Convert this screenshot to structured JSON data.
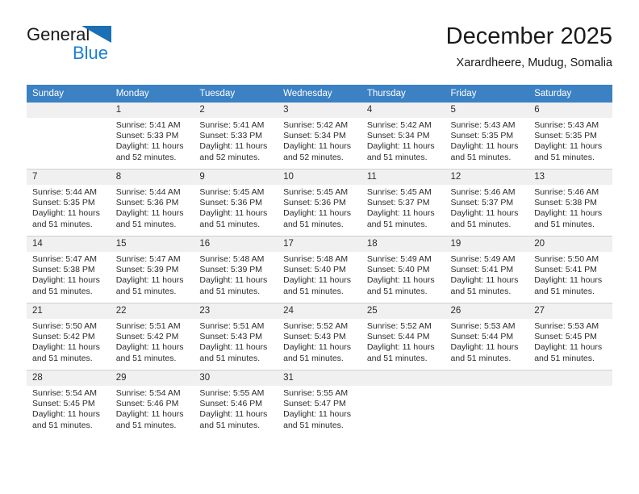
{
  "brand": {
    "name_part1": "General",
    "name_part2": "Blue",
    "accent_color": "#1a7fd4"
  },
  "header": {
    "title": "December 2025",
    "location": "Xarardheere, Mudug, Somalia"
  },
  "theme": {
    "header_row_bg": "#3b81c4",
    "daynum_bg": "#f0f0f0",
    "grid_line": "#cfcfcf",
    "text": "#2b2b2b"
  },
  "labels": {
    "sunrise_prefix": "Sunrise:",
    "sunset_prefix": "Sunset:",
    "daylight_prefix": "Daylight:"
  },
  "weekdays": [
    "Sunday",
    "Monday",
    "Tuesday",
    "Wednesday",
    "Thursday",
    "Friday",
    "Saturday"
  ],
  "weeks": [
    [
      {
        "day": "",
        "blank": true
      },
      {
        "day": "1",
        "sunrise": "Sunrise: 5:41 AM",
        "sunset": "Sunset: 5:33 PM",
        "daylight": "Daylight: 11 hours and 52 minutes."
      },
      {
        "day": "2",
        "sunrise": "Sunrise: 5:41 AM",
        "sunset": "Sunset: 5:33 PM",
        "daylight": "Daylight: 11 hours and 52 minutes."
      },
      {
        "day": "3",
        "sunrise": "Sunrise: 5:42 AM",
        "sunset": "Sunset: 5:34 PM",
        "daylight": "Daylight: 11 hours and 52 minutes."
      },
      {
        "day": "4",
        "sunrise": "Sunrise: 5:42 AM",
        "sunset": "Sunset: 5:34 PM",
        "daylight": "Daylight: 11 hours and 51 minutes."
      },
      {
        "day": "5",
        "sunrise": "Sunrise: 5:43 AM",
        "sunset": "Sunset: 5:35 PM",
        "daylight": "Daylight: 11 hours and 51 minutes."
      },
      {
        "day": "6",
        "sunrise": "Sunrise: 5:43 AM",
        "sunset": "Sunset: 5:35 PM",
        "daylight": "Daylight: 11 hours and 51 minutes."
      }
    ],
    [
      {
        "day": "7",
        "sunrise": "Sunrise: 5:44 AM",
        "sunset": "Sunset: 5:35 PM",
        "daylight": "Daylight: 11 hours and 51 minutes."
      },
      {
        "day": "8",
        "sunrise": "Sunrise: 5:44 AM",
        "sunset": "Sunset: 5:36 PM",
        "daylight": "Daylight: 11 hours and 51 minutes."
      },
      {
        "day": "9",
        "sunrise": "Sunrise: 5:45 AM",
        "sunset": "Sunset: 5:36 PM",
        "daylight": "Daylight: 11 hours and 51 minutes."
      },
      {
        "day": "10",
        "sunrise": "Sunrise: 5:45 AM",
        "sunset": "Sunset: 5:36 PM",
        "daylight": "Daylight: 11 hours and 51 minutes."
      },
      {
        "day": "11",
        "sunrise": "Sunrise: 5:45 AM",
        "sunset": "Sunset: 5:37 PM",
        "daylight": "Daylight: 11 hours and 51 minutes."
      },
      {
        "day": "12",
        "sunrise": "Sunrise: 5:46 AM",
        "sunset": "Sunset: 5:37 PM",
        "daylight": "Daylight: 11 hours and 51 minutes."
      },
      {
        "day": "13",
        "sunrise": "Sunrise: 5:46 AM",
        "sunset": "Sunset: 5:38 PM",
        "daylight": "Daylight: 11 hours and 51 minutes."
      }
    ],
    [
      {
        "day": "14",
        "sunrise": "Sunrise: 5:47 AM",
        "sunset": "Sunset: 5:38 PM",
        "daylight": "Daylight: 11 hours and 51 minutes."
      },
      {
        "day": "15",
        "sunrise": "Sunrise: 5:47 AM",
        "sunset": "Sunset: 5:39 PM",
        "daylight": "Daylight: 11 hours and 51 minutes."
      },
      {
        "day": "16",
        "sunrise": "Sunrise: 5:48 AM",
        "sunset": "Sunset: 5:39 PM",
        "daylight": "Daylight: 11 hours and 51 minutes."
      },
      {
        "day": "17",
        "sunrise": "Sunrise: 5:48 AM",
        "sunset": "Sunset: 5:40 PM",
        "daylight": "Daylight: 11 hours and 51 minutes."
      },
      {
        "day": "18",
        "sunrise": "Sunrise: 5:49 AM",
        "sunset": "Sunset: 5:40 PM",
        "daylight": "Daylight: 11 hours and 51 minutes."
      },
      {
        "day": "19",
        "sunrise": "Sunrise: 5:49 AM",
        "sunset": "Sunset: 5:41 PM",
        "daylight": "Daylight: 11 hours and 51 minutes."
      },
      {
        "day": "20",
        "sunrise": "Sunrise: 5:50 AM",
        "sunset": "Sunset: 5:41 PM",
        "daylight": "Daylight: 11 hours and 51 minutes."
      }
    ],
    [
      {
        "day": "21",
        "sunrise": "Sunrise: 5:50 AM",
        "sunset": "Sunset: 5:42 PM",
        "daylight": "Daylight: 11 hours and 51 minutes."
      },
      {
        "day": "22",
        "sunrise": "Sunrise: 5:51 AM",
        "sunset": "Sunset: 5:42 PM",
        "daylight": "Daylight: 11 hours and 51 minutes."
      },
      {
        "day": "23",
        "sunrise": "Sunrise: 5:51 AM",
        "sunset": "Sunset: 5:43 PM",
        "daylight": "Daylight: 11 hours and 51 minutes."
      },
      {
        "day": "24",
        "sunrise": "Sunrise: 5:52 AM",
        "sunset": "Sunset: 5:43 PM",
        "daylight": "Daylight: 11 hours and 51 minutes."
      },
      {
        "day": "25",
        "sunrise": "Sunrise: 5:52 AM",
        "sunset": "Sunset: 5:44 PM",
        "daylight": "Daylight: 11 hours and 51 minutes."
      },
      {
        "day": "26",
        "sunrise": "Sunrise: 5:53 AM",
        "sunset": "Sunset: 5:44 PM",
        "daylight": "Daylight: 11 hours and 51 minutes."
      },
      {
        "day": "27",
        "sunrise": "Sunrise: 5:53 AM",
        "sunset": "Sunset: 5:45 PM",
        "daylight": "Daylight: 11 hours and 51 minutes."
      }
    ],
    [
      {
        "day": "28",
        "sunrise": "Sunrise: 5:54 AM",
        "sunset": "Sunset: 5:45 PM",
        "daylight": "Daylight: 11 hours and 51 minutes."
      },
      {
        "day": "29",
        "sunrise": "Sunrise: 5:54 AM",
        "sunset": "Sunset: 5:46 PM",
        "daylight": "Daylight: 11 hours and 51 minutes."
      },
      {
        "day": "30",
        "sunrise": "Sunrise: 5:55 AM",
        "sunset": "Sunset: 5:46 PM",
        "daylight": "Daylight: 11 hours and 51 minutes."
      },
      {
        "day": "31",
        "sunrise": "Sunrise: 5:55 AM",
        "sunset": "Sunset: 5:47 PM",
        "daylight": "Daylight: 11 hours and 51 minutes."
      },
      {
        "day": "",
        "blank": true
      },
      {
        "day": "",
        "blank": true
      },
      {
        "day": "",
        "blank": true
      }
    ]
  ]
}
